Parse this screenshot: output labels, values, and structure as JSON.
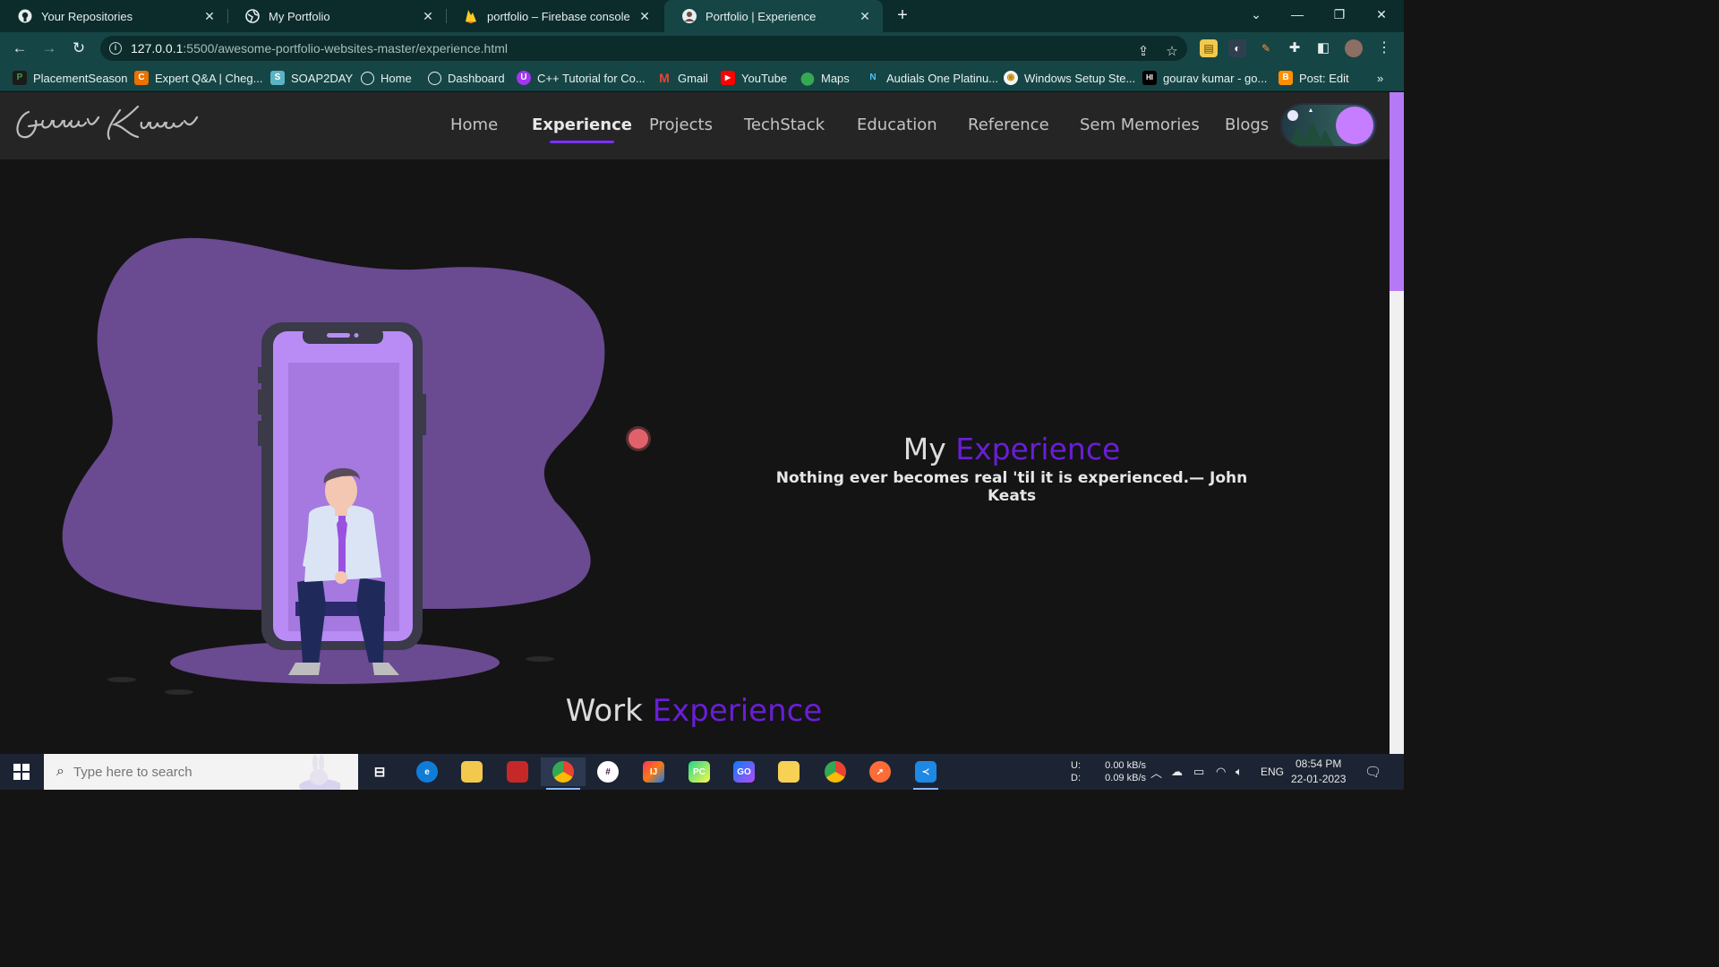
{
  "browser": {
    "tabs": [
      {
        "title": "Your Repositories",
        "icon": "github-icon"
      },
      {
        "title": "My Portfolio",
        "icon": "globe-icon"
      },
      {
        "title": "portfolio – Firebase console",
        "icon": "firebase-icon"
      },
      {
        "title": "Portfolio | Experience",
        "icon": "avatar-icon"
      }
    ],
    "url_host": "127.0.0.1",
    "url_path": ":5500/awesome-portfolio-websites-master/experience.html",
    "bookmarks": [
      {
        "label": "PlacementSeason",
        "icon": "p-icon"
      },
      {
        "label": "Expert Q&A | Cheg...",
        "icon": "chegg-icon"
      },
      {
        "label": "SOAP2DAY",
        "icon": "s-icon"
      },
      {
        "label": "Home",
        "icon": "globe-icon"
      },
      {
        "label": "Dashboard",
        "icon": "globe-icon"
      },
      {
        "label": "C++ Tutorial for Co...",
        "icon": "u-icon"
      },
      {
        "label": "Gmail",
        "icon": "gmail-icon"
      },
      {
        "label": "YouTube",
        "icon": "youtube-icon"
      },
      {
        "label": "Maps",
        "icon": "maps-icon"
      },
      {
        "label": "Audials One Platinu...",
        "icon": "n-icon"
      },
      {
        "label": "Windows Setup Ste...",
        "icon": "setup-icon"
      },
      {
        "label": "gourav kumar - go...",
        "icon": "hi-icon"
      },
      {
        "label": "Post: Edit",
        "icon": "blogger-icon"
      }
    ],
    "bookmarks_overflow": "»"
  },
  "site": {
    "logo_text": "Gourav Kumar",
    "nav": [
      "Home",
      "Experience",
      "Projects",
      "TechStack",
      "Education",
      "Reference",
      "Sem Memories",
      "Blogs"
    ],
    "active_nav": "Experience",
    "hero": {
      "title_white": "My",
      "title_purple": "Experience",
      "quote": "Nothing ever becomes real 'til it is experienced.— John Keats"
    },
    "section": {
      "title_white": "Work",
      "title_purple": "Experience"
    },
    "colors": {
      "accent": "#6a1ed6",
      "blob": "#6a4a91",
      "background": "#141414"
    }
  },
  "taskbar": {
    "search_placeholder": "Type here to search",
    "net_up_label": "U:",
    "net_up": "0.00 kB/s",
    "net_down_label": "D:",
    "net_down": "0.09 kB/s",
    "language": "ENG",
    "time": "08:54 PM",
    "date": "22-01-2023"
  }
}
